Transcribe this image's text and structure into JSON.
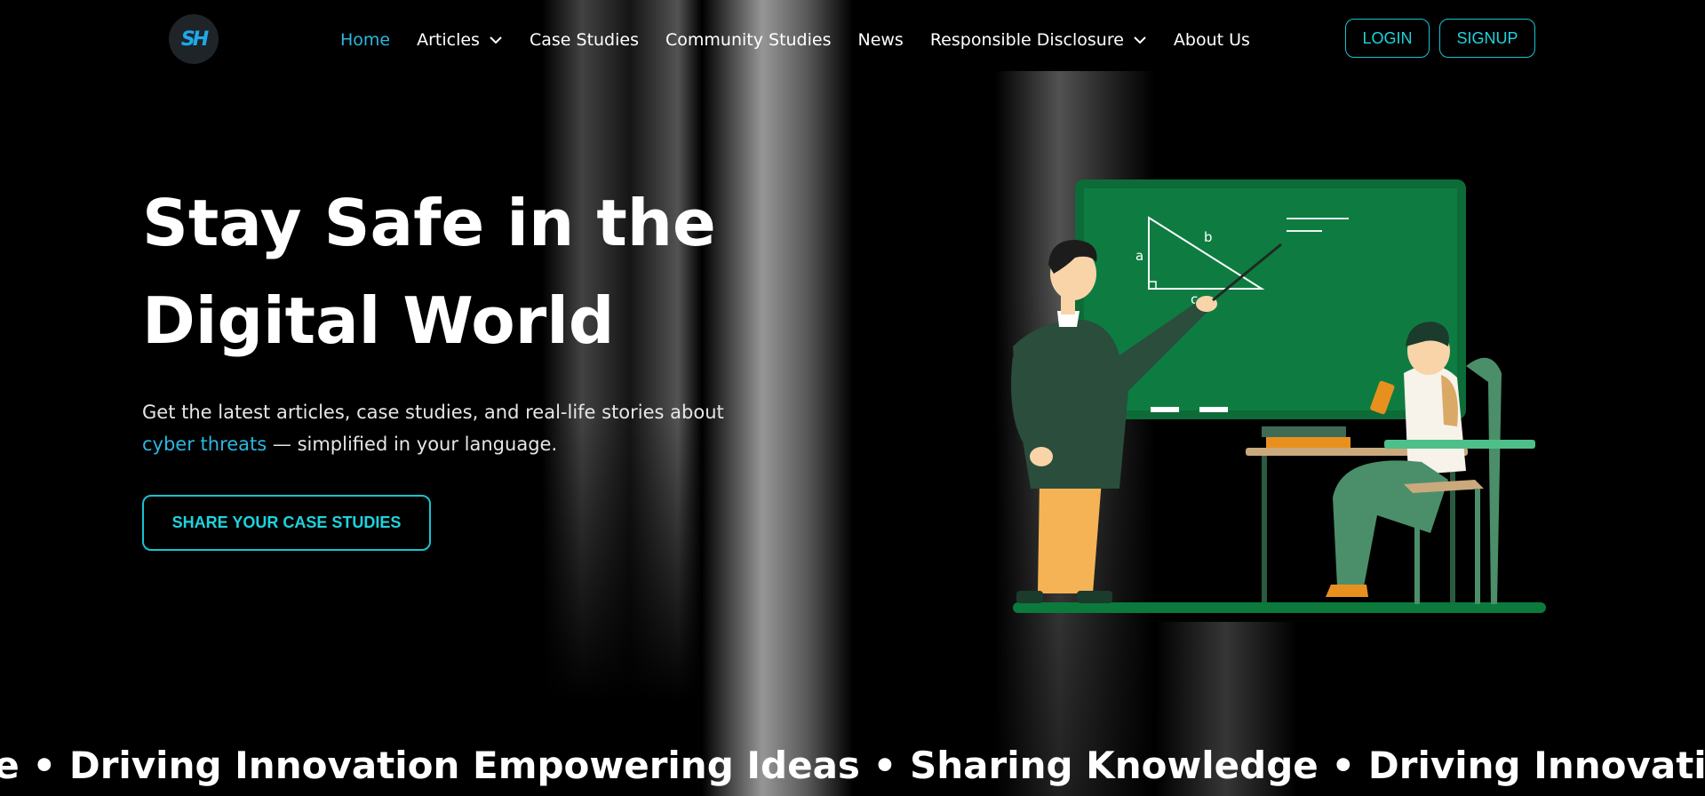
{
  "header": {
    "logo_text": "SH",
    "nav": [
      {
        "label": "Home",
        "active": true
      },
      {
        "label": "Articles",
        "dropdown": true
      },
      {
        "label": "Case Studies"
      },
      {
        "label": "Community Studies"
      },
      {
        "label": "News"
      },
      {
        "label": "Responsible Disclosure",
        "dropdown": true
      },
      {
        "label": "About Us"
      }
    ],
    "login_label": "LOGIN",
    "signup_label": "SIGNUP"
  },
  "hero": {
    "title_line1": "Stay Safe in the",
    "title_line2": "Digital World",
    "subtitle_before": "Get the latest articles, case studies, and real-life stories about ",
    "subtitle_highlight": "cyber threats",
    "subtitle_after": " — simplified in your language.",
    "cta_label": "SHARE YOUR CASE STUDIES"
  },
  "illustration": {
    "board_labels": {
      "a": "a",
      "b": "b",
      "c": "c"
    }
  },
  "marquee": {
    "text": "Empowering Ideas • Sharing Knowledge • Driving Innovation"
  },
  "colors": {
    "accent": "#2ab7e0",
    "button_border": "#17c3cf",
    "background": "#000000",
    "board_green": "#0b7a3c"
  }
}
